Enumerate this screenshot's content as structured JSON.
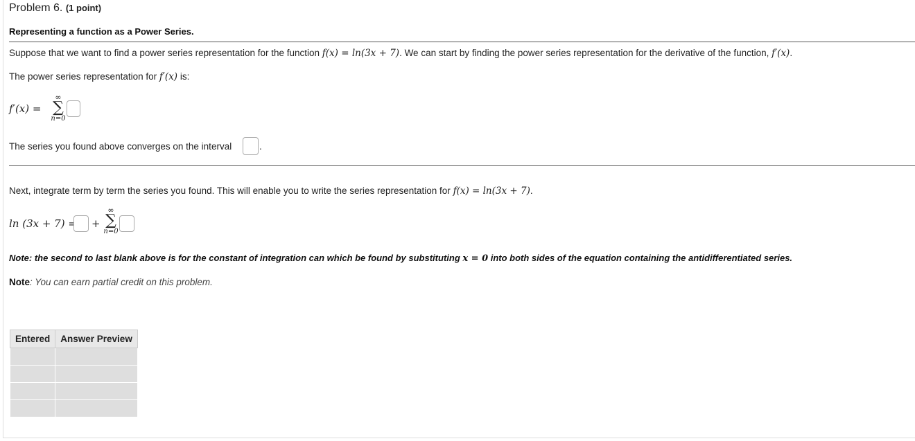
{
  "header": {
    "problem_label": "Problem 6.",
    "points_label": "(1 point)",
    "subtitle": "Representing a function as a Power Series."
  },
  "intro": {
    "text_before": "Suppose that we want to find a power series representation for the function ",
    "function_math": "f(x) = ln(3x + 7)",
    "text_after": ". We can start by finding the power series representation for the derivative of the function, ",
    "derivative_math": "f′(x)",
    "end": "."
  },
  "part1": {
    "prompt_before": "The power series representation for ",
    "prompt_math": "f′(x)",
    "prompt_after": " is:",
    "lhs_math": "f′(x) =",
    "sum_upper": "∞",
    "sum_symbol": "∑",
    "sum_lower": "n=0",
    "interval_text": "The series you found above converges on the interval",
    "interval_end": "."
  },
  "part2": {
    "text_before": "Next, integrate term by term the series you found. This will enable you to write the series representation for ",
    "math": "f(x) = ln(3x + 7)",
    "end": ".",
    "lhs_math": "ln (3x + 7) =",
    "plus": "+",
    "sum_upper": "∞",
    "sum_symbol": "∑",
    "sum_lower": "n=0"
  },
  "notes": {
    "note1_before": "Note: the second to last blank above is for the constant of integration can which be found by substituting ",
    "note1_math": "x = 0",
    "note1_after": " into both sides of the equation containing the antidifferentiated series.",
    "note2_label": "Note",
    "note2_text": ": You can earn partial credit on this problem."
  },
  "answer_table": {
    "headers": [
      "Entered",
      "Answer Preview"
    ],
    "row_count": 4
  }
}
